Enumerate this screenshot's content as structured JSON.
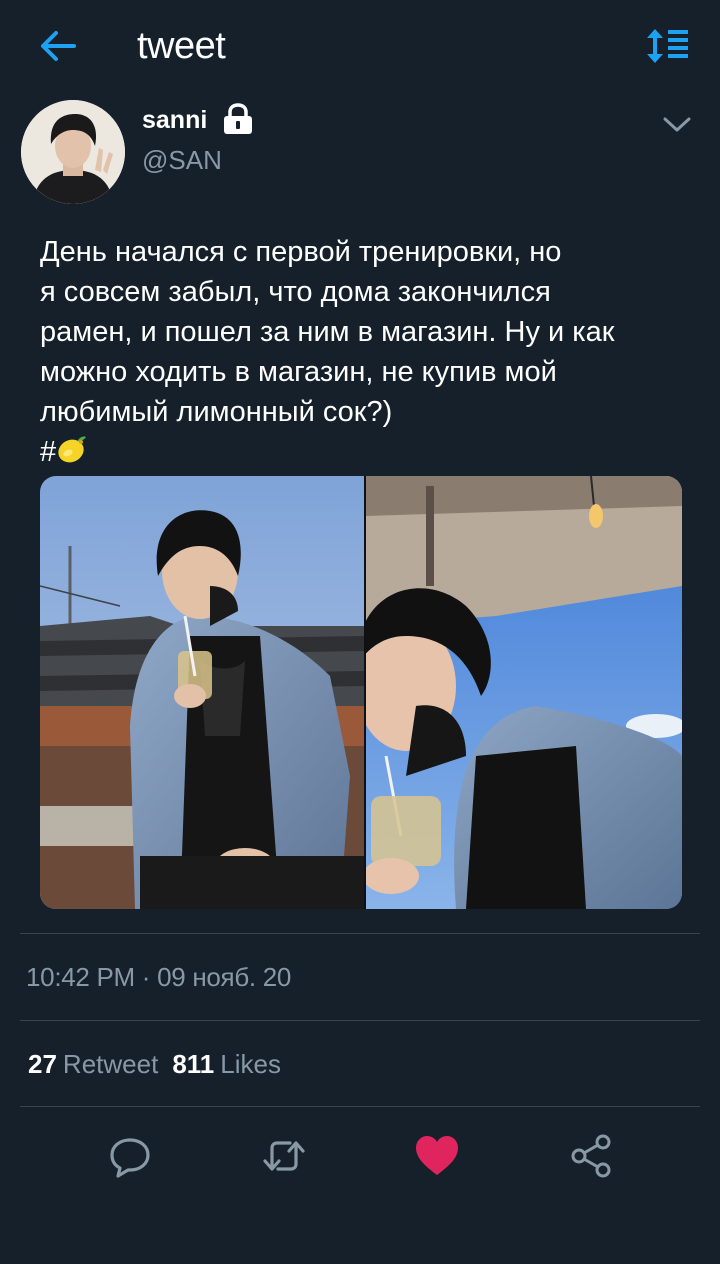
{
  "header": {
    "title": "tweet",
    "back_icon": "arrow-left-icon",
    "sort_icon": "sort-list-icon",
    "accent_color": "#1da1f2"
  },
  "user": {
    "name": "sanni",
    "handle": "@SAN",
    "protected_icon": "lock-icon"
  },
  "tweet": {
    "text": "День начался с первой тренировки, но\nя совсем забыл, что дома закончился\nрамен, и пошел за ним в магазин. Ну и как\nможно ходить в магазин, не купив мой\nлюбимый лимонный сок?)",
    "hashtag": "#",
    "hashtag_emoji": "lemon-icon"
  },
  "media": {
    "count": 2
  },
  "meta": {
    "timestamp": "10:42 PM · 09 нояб. 20"
  },
  "stats": {
    "retweets_count": "27",
    "retweets_label": "Retweet",
    "likes_count": "811",
    "likes_label": "Likes"
  },
  "actions": [
    {
      "icon": "reply-icon"
    },
    {
      "icon": "retweet-icon"
    },
    {
      "icon": "heart-icon",
      "active": true,
      "color": "#e0245e"
    },
    {
      "icon": "share-icon"
    }
  ],
  "colors": {
    "background": "#15202b",
    "secondary_text": "#8899a6",
    "divider": "#38444d",
    "like": "#e0245e"
  }
}
